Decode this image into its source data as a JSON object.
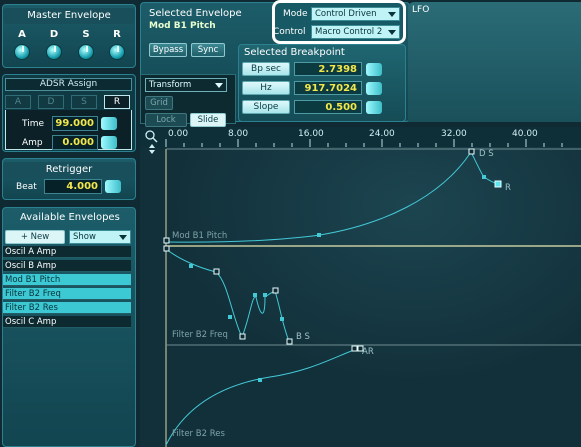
{
  "master_envelope": {
    "title": "Master Envelope",
    "knobs": [
      "A",
      "D",
      "S",
      "R"
    ]
  },
  "adsr_assign": {
    "title": "ADSR Assign",
    "tabs": [
      "A",
      "D",
      "S",
      "R"
    ],
    "active_tab": "R",
    "time_label": "Time",
    "time_value": "99.000",
    "amp_label": "Amp",
    "amp_value": "0.000"
  },
  "retrigger": {
    "title": "Retrigger",
    "beat_label": "Beat",
    "beat_value": "4.000"
  },
  "available_envelopes": {
    "title": "Available Envelopes",
    "new_label": "+ New",
    "show_label": "Show",
    "items": [
      {
        "label": "Oscil A Amp",
        "selected": false
      },
      {
        "label": "Oscil B Amp",
        "selected": false
      },
      {
        "label": "Mod B1 Pitch",
        "selected": true
      },
      {
        "label": "Filter B2 Freq",
        "selected": true
      },
      {
        "label": "Filter B2 Res",
        "selected": true
      },
      {
        "label": "Oscil C Amp",
        "selected": false
      }
    ]
  },
  "selected_envelope": {
    "title": "Selected Envelope",
    "name": "Mod B1 Pitch",
    "bypass_label": "Bypass",
    "sync_label": "Sync",
    "mode_label": "Mode",
    "mode_value": "Control Driven",
    "control_label": "Control",
    "control_value": "Macro Control 2"
  },
  "selected_breakpoint": {
    "title": "Selected Breakpoint",
    "rows": [
      {
        "label": "Bp sec",
        "value": "2.7398"
      },
      {
        "label": "Hz",
        "value": "917.7024"
      },
      {
        "label": "Slope",
        "value": "0.500"
      }
    ]
  },
  "lfo_label": "LFO",
  "editor": {
    "transform_label": "Transform",
    "grid_label": "Grid",
    "lock_label": "Lock",
    "slide_label": "Slide",
    "ruler": [
      "0.00",
      "8.00",
      "16.00",
      "24.00",
      "32.00",
      "40.00"
    ],
    "envelopes": [
      {
        "name": "Mod B1 Pitch",
        "tags": [
          "D S",
          "R"
        ]
      },
      {
        "name": "Filter B2 Freq",
        "tags": [
          "B S"
        ]
      },
      {
        "name": "Filter B2 Res",
        "tags": [
          "AR"
        ]
      }
    ]
  },
  "colors": {
    "curve": "#43c9d6",
    "value_text": "#f3e84a",
    "selected_row": "#3cc9d3",
    "active_lane_line": "#e8e7b0"
  }
}
